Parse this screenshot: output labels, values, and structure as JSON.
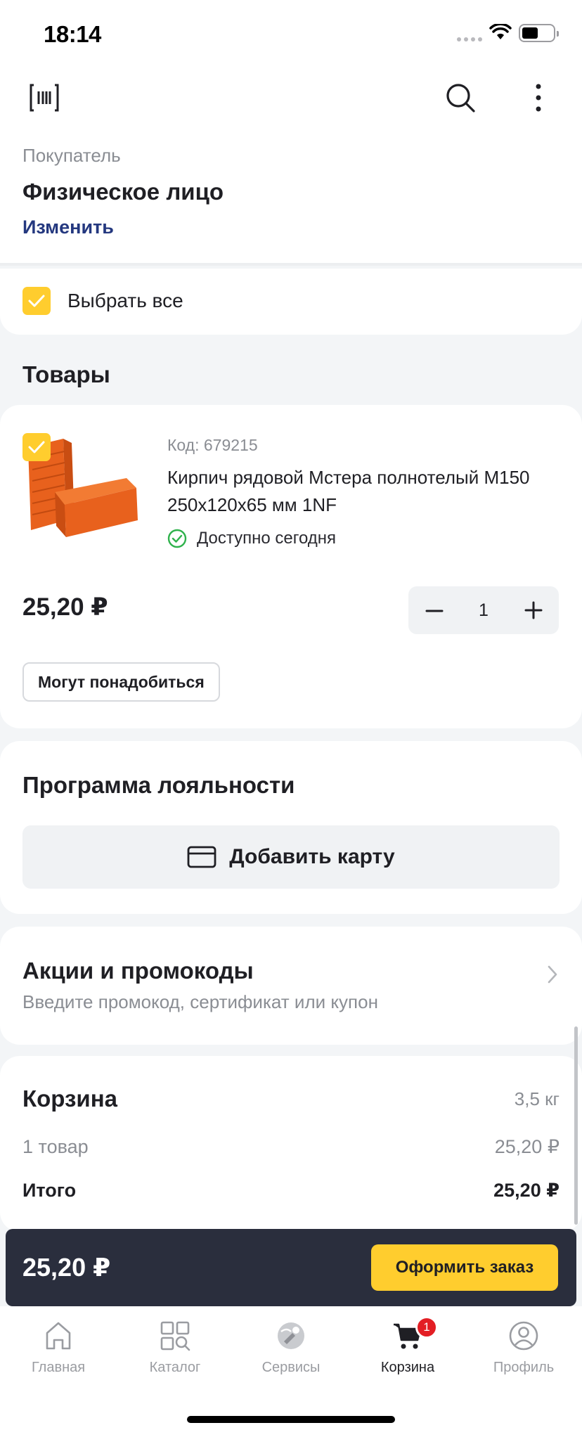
{
  "status_bar": {
    "time": "18:14"
  },
  "buyer": {
    "label": "Покупатель",
    "value": "Физическое лицо",
    "change_link": "Изменить"
  },
  "select_all": {
    "label": "Выбрать все",
    "checked": true
  },
  "products_section": {
    "title": "Товары"
  },
  "product": {
    "code": "Код: 679215",
    "name": "Кирпич рядовой Мстера полнотелый М150 250х120х65 мм 1NF",
    "availability": "Доступно сегодня",
    "price": "25,20 ₽",
    "quantity": "1",
    "checked": true,
    "may_need_label": "Могут понадобиться"
  },
  "loyalty": {
    "title": "Программа лояльности",
    "add_card_label": "Добавить карту"
  },
  "promo": {
    "title": "Акции и промокоды",
    "subtitle": "Введите промокод, сертификат или купон"
  },
  "summary": {
    "title": "Корзина",
    "weight": "3,5 кг",
    "items_label": "1 товар",
    "items_value": "25,20 ₽",
    "total_label": "Итого",
    "total_value": "25,20 ₽"
  },
  "checkout": {
    "total": "25,20 ₽",
    "button_label": "Оформить заказ"
  },
  "tabs": [
    {
      "label": "Главная",
      "icon": "home-icon"
    },
    {
      "label": "Каталог",
      "icon": "catalog-icon"
    },
    {
      "label": "Сервисы",
      "icon": "services-icon"
    },
    {
      "label": "Корзина",
      "icon": "cart-icon",
      "badge": "1",
      "active": true
    },
    {
      "label": "Профиль",
      "icon": "profile-icon"
    }
  ],
  "colors": {
    "accent_yellow": "#ffcd2e",
    "link_blue": "#24387f",
    "dark_bar": "#2a2e3d",
    "badge_red": "#e31e24",
    "success_green": "#2fb24c"
  }
}
